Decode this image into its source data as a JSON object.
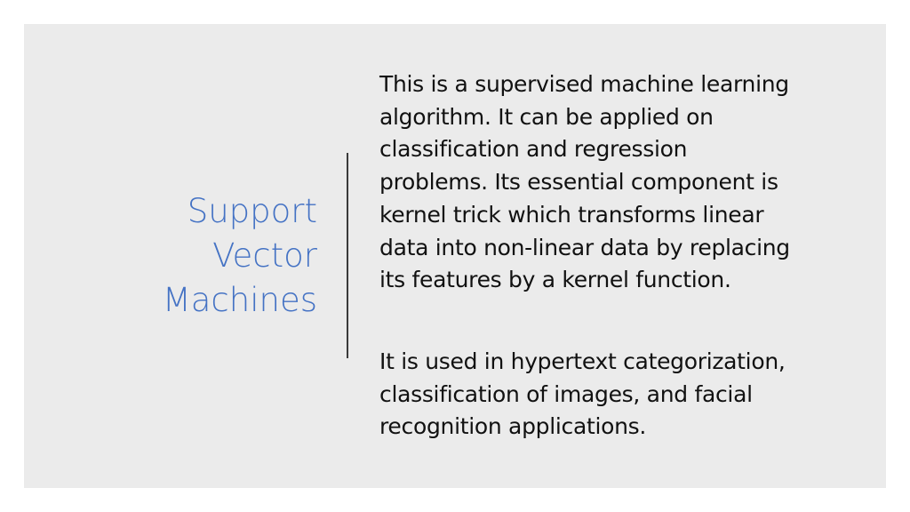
{
  "slide": {
    "title_lines": [
      "Support",
      "Vector",
      "Machines"
    ],
    "paragraph1_lines": [
      "This is a supervised machine learning",
      "algorithm. It can be applied on",
      "classification and regression",
      "problems. Its essential component is",
      "kernel trick which transforms linear",
      "data into non-linear data by replacing",
      "its features by a kernel function."
    ],
    "paragraph2_lines": [
      "It is used in hypertext categorization,",
      "classification of images, and facial",
      "recognition applications."
    ],
    "colors": {
      "title": "#4472c4",
      "background": "#ebebeb",
      "text": "#111111",
      "divider": "#3a3a3a"
    }
  }
}
